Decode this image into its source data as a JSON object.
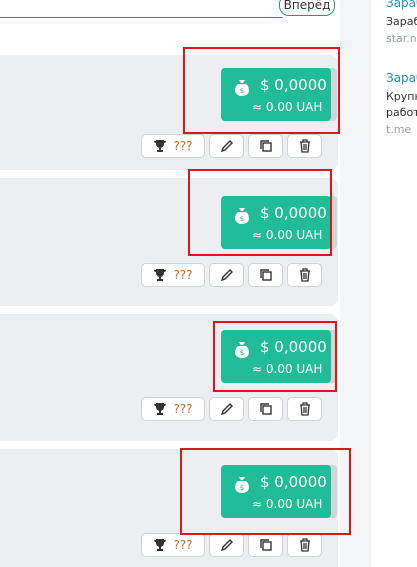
{
  "pagination": {
    "next_label": "Вперёд"
  },
  "sidebar": {
    "items": [
      {
        "title": "Зараб",
        "text": "Зараб",
        "url": "star.ni"
      },
      {
        "title": "Зараб",
        "text1": "Крупн",
        "text2": "работ",
        "url": "t.me"
      }
    ]
  },
  "cards": [
    {
      "usd": "$ 0,0000",
      "uah": "≈ 0.00 UAH",
      "stats": "???"
    },
    {
      "usd": "$ 0,0000",
      "uah": "≈ 0.00 UAH",
      "stats": "???"
    },
    {
      "usd": "$ 0,0000",
      "uah": "≈ 0.00 UAH",
      "stats": "???"
    },
    {
      "usd": "$ 0,0000",
      "uah": "≈ 0.00 UAH",
      "stats": "???"
    }
  ],
  "colors": {
    "accent": "#20bb97",
    "highlight": "#e0141e",
    "question": "#c86b1e"
  },
  "icons": [
    "money-bag-icon",
    "trophy-icon",
    "pencil-icon",
    "copy-icon",
    "trash-icon"
  ]
}
